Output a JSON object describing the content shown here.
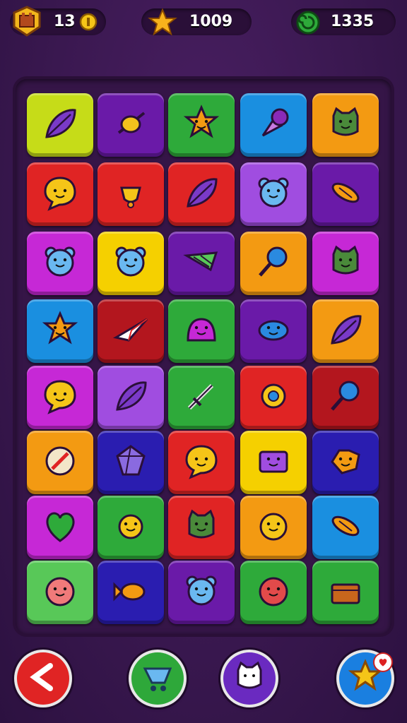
{
  "hud": {
    "level_count": "13",
    "stars": "1009",
    "gems": "1335"
  },
  "board": {
    "rows": 8,
    "cols": 5,
    "tiles": [
      [
        "lime",
        "leaf-icon"
      ],
      [
        "purple",
        "candy-icon"
      ],
      [
        "green",
        "star-face-icon"
      ],
      [
        "blue",
        "ice-cream-icon"
      ],
      [
        "orange",
        "cat-face-icon"
      ],
      [
        "red",
        "chat-bubble-icon"
      ],
      [
        "red",
        "bell-icon"
      ],
      [
        "red",
        "leaf-icon"
      ],
      [
        "violet",
        "bear-face-icon"
      ],
      [
        "purple",
        "wrapped-candy-icon"
      ],
      [
        "magenta",
        "bear-face-icon"
      ],
      [
        "yellow",
        "bear-face-icon"
      ],
      [
        "purple",
        "leaf-slice-icon"
      ],
      [
        "orange",
        "lollipop-icon"
      ],
      [
        "magenta",
        "cat-face-icon"
      ],
      [
        "blue",
        "star-face-icon"
      ],
      [
        "darkred",
        "paper-plane-icon"
      ],
      [
        "green",
        "dome-creature-icon"
      ],
      [
        "purple",
        "cloud-face-icon"
      ],
      [
        "orange",
        "leaf-icon"
      ],
      [
        "magenta",
        "chat-bubble-icon"
      ],
      [
        "violet",
        "leaf-icon"
      ],
      [
        "green",
        "sword-icon"
      ],
      [
        "red",
        "sun-gear-icon"
      ],
      [
        "darkred",
        "lollipop-icon"
      ],
      [
        "orange",
        "circle-leaf-icon"
      ],
      [
        "indigo",
        "gem-icon"
      ],
      [
        "red",
        "chat-bubble-icon"
      ],
      [
        "yellow",
        "box-creature-icon"
      ],
      [
        "indigo",
        "spiky-fish-icon"
      ],
      [
        "magenta",
        "heart-leaf-icon"
      ],
      [
        "green",
        "sun-face-icon"
      ],
      [
        "red",
        "cat-face-icon"
      ],
      [
        "orange",
        "smiley-icon"
      ],
      [
        "blue",
        "wrapped-candy-icon"
      ],
      [
        "lightgreen",
        "blob-face-icon"
      ],
      [
        "indigo",
        "fish-icon"
      ],
      [
        "purple",
        "bear-face-icon"
      ],
      [
        "green",
        "gear-face-icon"
      ],
      [
        "green",
        "treasure-chest-icon"
      ]
    ]
  },
  "colors": {
    "lime": "#c6dc18",
    "purple": "#6a1aa8",
    "green": "#2eaa3a",
    "blue": "#1a8fe0",
    "orange": "#f39a12",
    "red": "#e02424",
    "violet": "#a04de0",
    "magenta": "#c628d6",
    "yellow": "#f5d000",
    "darkred": "#b3161e",
    "indigo": "#2a1db0",
    "lightgreen": "#58c858"
  },
  "buttons": [
    {
      "name": "back-button",
      "icon": "back-arrow-icon",
      "color": "#e02424"
    },
    {
      "name": "shop-button",
      "icon": "cart-icon",
      "color": "#2ea83a"
    },
    {
      "name": "pet-button",
      "icon": "cat-face-icon",
      "color": "#6a2ac0"
    },
    {
      "name": "rewards-button",
      "icon": "star-badge-icon",
      "color": "#1a7fe0"
    }
  ]
}
